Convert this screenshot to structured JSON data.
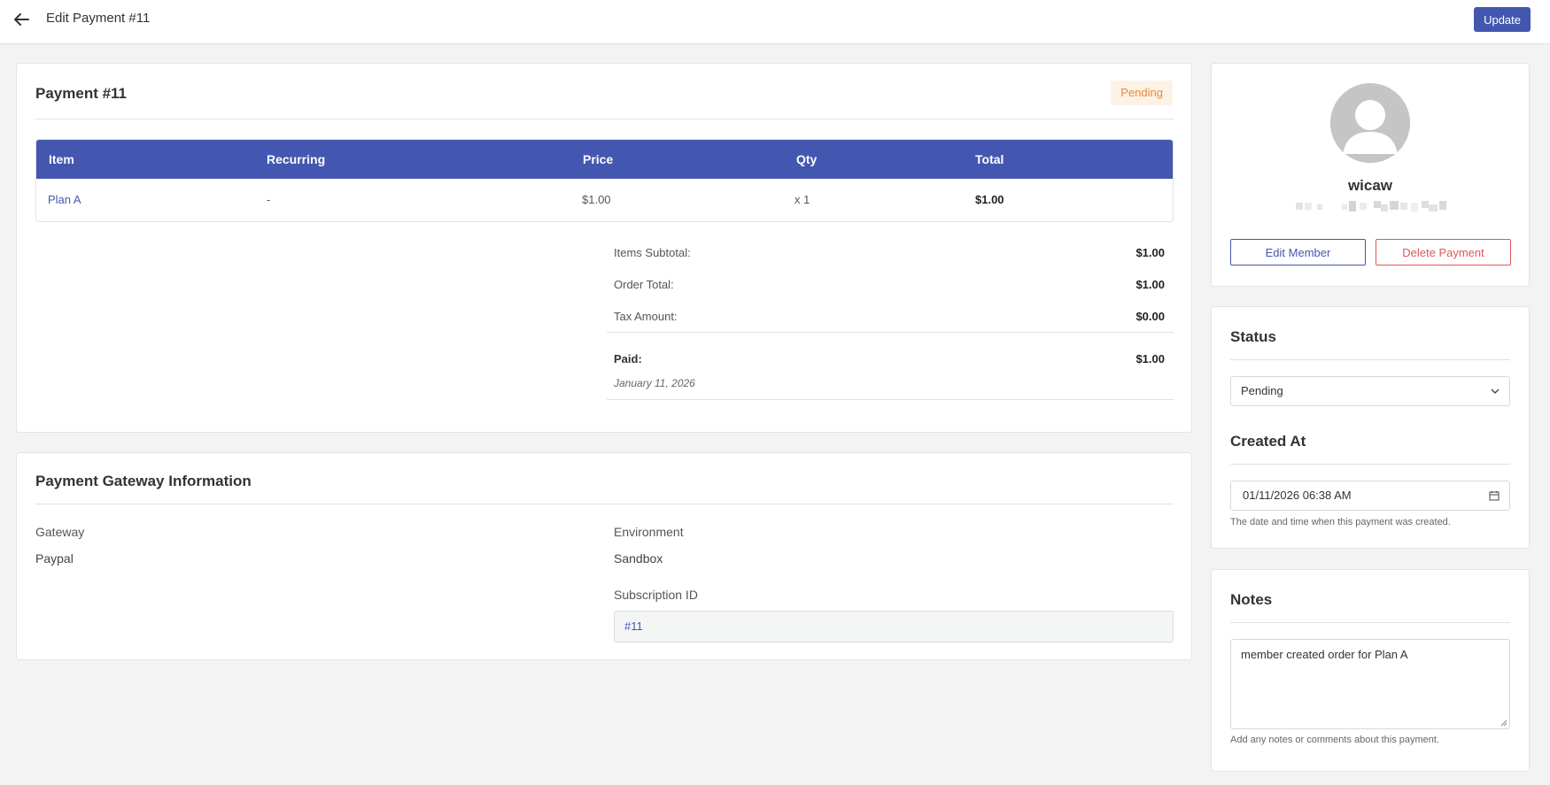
{
  "header": {
    "title": "Edit Payment #11",
    "update_label": "Update",
    "back_icon": "arrow-left-icon"
  },
  "payment": {
    "title": "Payment #11",
    "status_badge": "Pending",
    "table": {
      "headers": [
        "Item",
        "Recurring",
        "Price",
        "Qty",
        "Total"
      ],
      "rows": [
        [
          "Plan A",
          "-",
          "$1.00",
          "x 1",
          "$1.00"
        ]
      ]
    },
    "summary": {
      "items_subtotal_label": "Items Subtotal:",
      "items_subtotal": "$1.00",
      "order_total_label": "Order Total:",
      "order_total": "$1.00",
      "tax_label": "Tax Amount:",
      "tax": "$0.00",
      "paid_label": "Paid:",
      "paid": "$1.00",
      "paid_date": "January 11, 2026"
    }
  },
  "gateway": {
    "title": "Payment Gateway Information",
    "gateway_label": "Gateway",
    "gateway_value": "Paypal",
    "environment_label": "Environment",
    "environment_value": "Sandbox",
    "subscription_label": "Subscription ID",
    "subscription_value": "#11"
  },
  "member": {
    "name": "wicaw",
    "edit_label": "Edit Member",
    "delete_label": "Delete Payment",
    "avatar_icon": "user-avatar-icon"
  },
  "status": {
    "title": "Status",
    "selected": "Pending",
    "created_title": "Created At",
    "created_value": "01/11/2026 06:38 AM",
    "created_help": "The date and time when this payment was created."
  },
  "notes": {
    "title": "Notes",
    "value": "member created order for Plan A",
    "help": "Add any notes or comments about this payment."
  },
  "colors": {
    "primary": "#4457b0",
    "danger": "#e25656",
    "pending_text": "#e8883a",
    "pending_bg": "#fdf2e6",
    "page_bg": "#f3f3f3"
  }
}
